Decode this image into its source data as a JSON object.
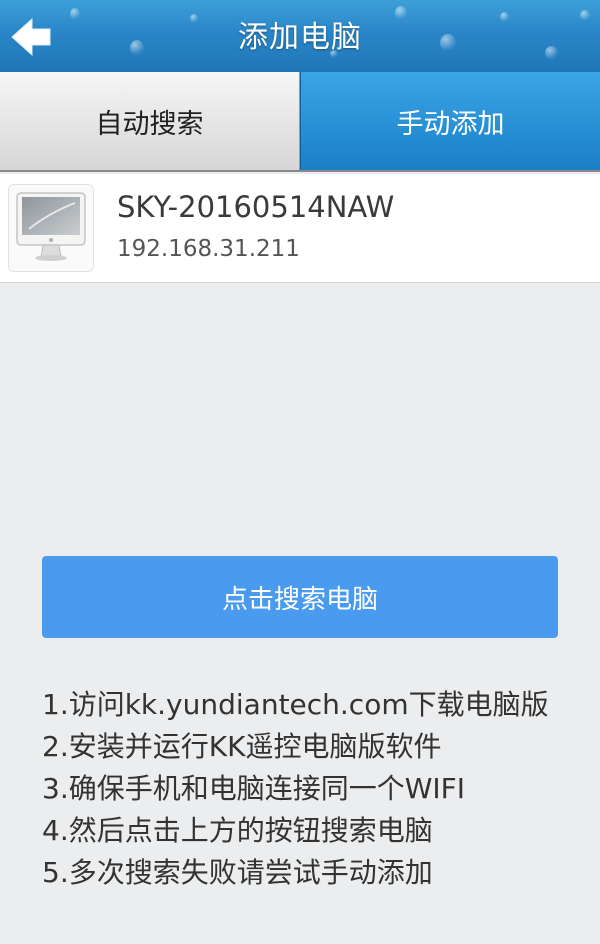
{
  "header": {
    "title": "添加电脑",
    "back_icon": "back-arrow-icon"
  },
  "tabs": [
    {
      "label": "自动搜索",
      "active": false
    },
    {
      "label": "手动添加",
      "active": true
    }
  ],
  "device": {
    "icon": "computer-monitor-icon",
    "name": "SKY-20160514NAW",
    "ip": "192.168.31.211"
  },
  "search_button": {
    "label": "点击搜索电脑"
  },
  "instructions": [
    "1.访问kk.yundiantech.com下载电脑版",
    "2.安装并运行KK遥控电脑版软件",
    "3.确保手机和电脑连接同一个WIFI",
    "4.然后点击上方的按钮搜索电脑",
    "5.多次搜索失败请尝试手动添加"
  ],
  "colors": {
    "header_blue": "#2a86c8",
    "active_tab": "#1b7fc6",
    "button_blue": "#4a9bef",
    "background": "#ecedee"
  }
}
